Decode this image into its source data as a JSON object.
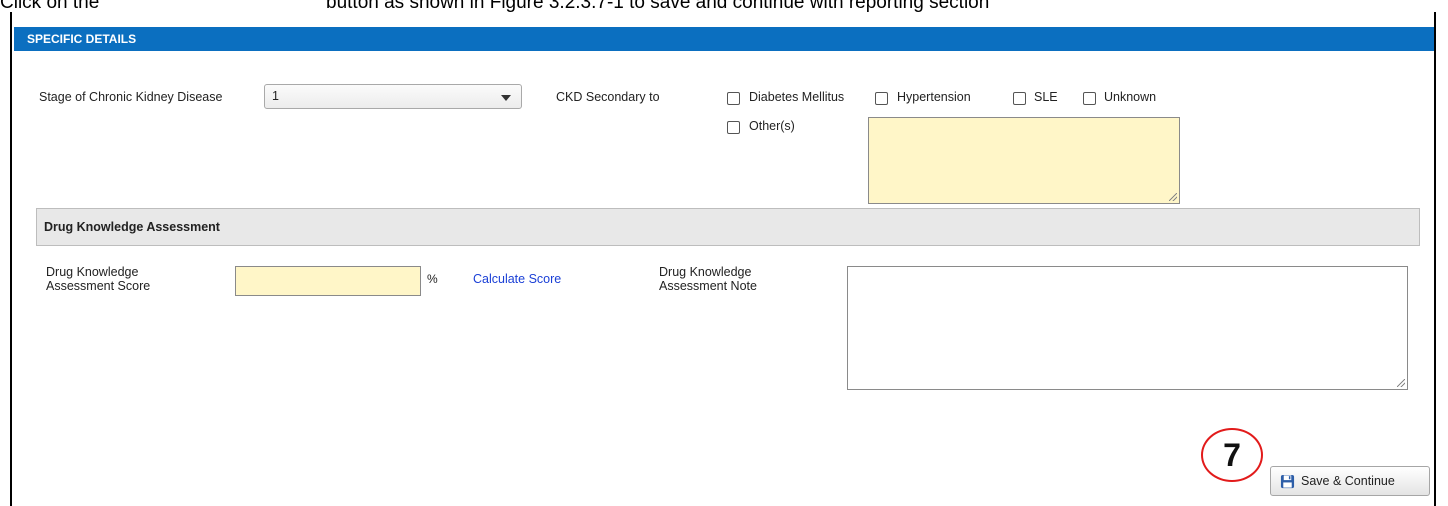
{
  "instruction": {
    "prefix": "Click on the",
    "suffix": "button as shown in Figure 3.2.3.7-1 to save and continue with reporting section"
  },
  "section": {
    "title": "SPECIFIC DETAILS"
  },
  "ckd_stage": {
    "label": "Stage of Chronic Kidney Disease",
    "value": "1"
  },
  "ckd_secondary": {
    "label": "CKD Secondary to",
    "options": [
      {
        "label": "Diabetes Mellitus",
        "checked": false
      },
      {
        "label": "Hypertension",
        "checked": false
      },
      {
        "label": "SLE",
        "checked": false
      },
      {
        "label": "Unknown",
        "checked": false
      },
      {
        "label": "Other(s)",
        "checked": false
      }
    ],
    "other_text": ""
  },
  "drug_knowledge": {
    "section_title": "Drug Knowledge Assessment",
    "score_label_line1": "Drug Knowledge",
    "score_label_line2": "Assessment Score",
    "score_value": "",
    "percent": "%",
    "calculate_link": "Calculate Score",
    "note_label_line1": "Drug Knowledge",
    "note_label_line2": "Assessment Note",
    "note_value": ""
  },
  "annotation": {
    "step": "7"
  },
  "actions": {
    "save_label": "Save & Continue"
  },
  "colors": {
    "header": "#0b6fc0",
    "input_highlight": "#fff6c8",
    "link": "#1a3fd6",
    "callout": "#e21b1b"
  },
  "icons": {
    "save": "floppy-disk-icon"
  }
}
